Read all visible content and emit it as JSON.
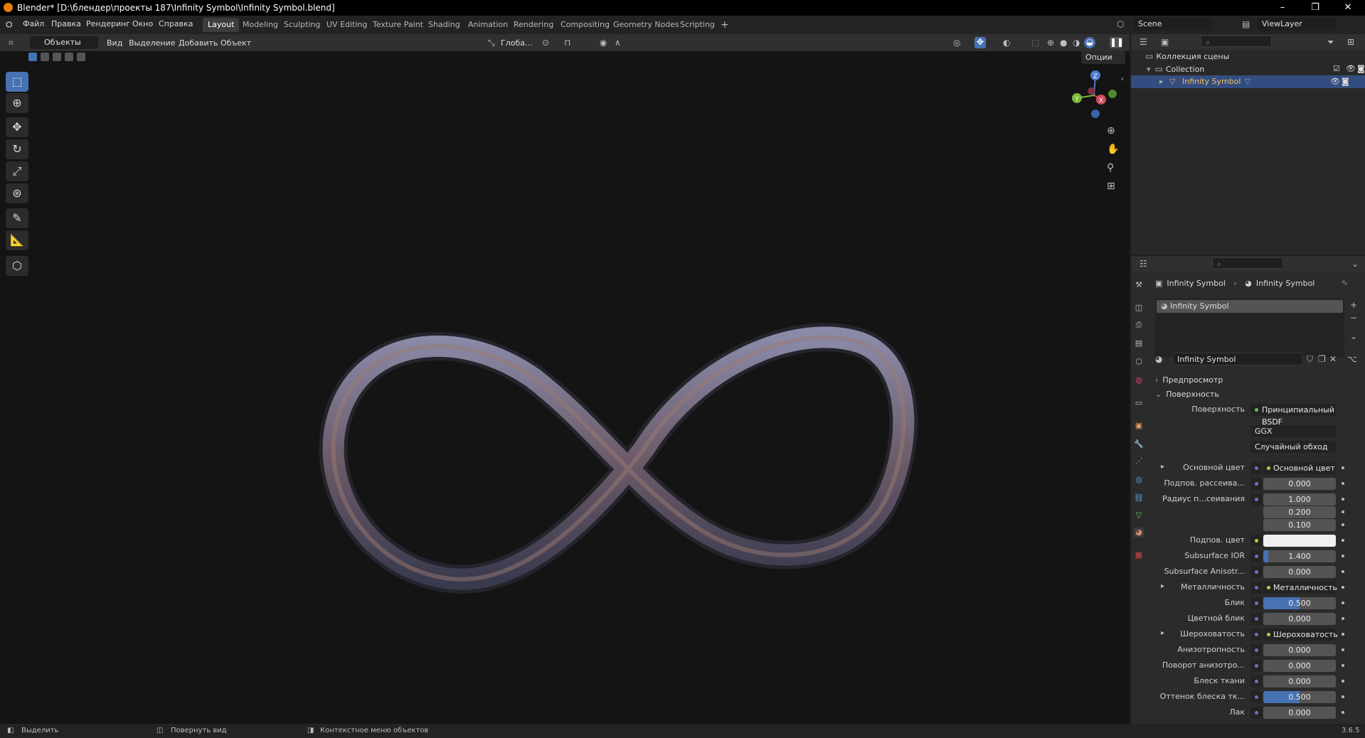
{
  "window": {
    "title": "Blender* [D:\\блендер\\проекты 187\\Infinity Symbol\\Infinity Symbol.blend]",
    "controls": [
      "–",
      "❐",
      "✕"
    ]
  },
  "menus": [
    "Файл",
    "Правка",
    "Рендеринг",
    "Окно",
    "Справка"
  ],
  "workspaces": [
    "Layout",
    "Modeling",
    "Sculpting",
    "UV Editing",
    "Texture Paint",
    "Shading",
    "Animation",
    "Rendering",
    "Compositing",
    "Geometry Nodes",
    "Scripting",
    "+"
  ],
  "active_workspace": "Layout",
  "scene": {
    "label": "Scene",
    "view_layer": "ViewLayer"
  },
  "viewport_header": {
    "mode": "Объекты",
    "menus": [
      "Вид",
      "Выделение",
      "Добавить",
      "Объект"
    ],
    "transform": "Глоба...",
    "options": "Опции"
  },
  "tools": [
    "select",
    "cursor",
    "move",
    "rotate",
    "scale",
    "transform",
    "annotate",
    "measure",
    "add-cube"
  ],
  "gizmo": {
    "z": "Z",
    "x": "X",
    "y": "Y"
  },
  "outliner": {
    "root": "Коллекция сцены",
    "collection": "Collection",
    "object": "Infinity Symbol"
  },
  "properties": {
    "breadcrumb_object": "Infinity Symbol",
    "breadcrumb_material": "Infinity Symbol",
    "slot": "Infinity Symbol",
    "material_name": "Infinity Symbol",
    "preview": "Предпросмотр",
    "surface_panel": "Поверхность",
    "surface_label": "Поверхность",
    "surface_value": "Принципиальный BSDF",
    "distribution": "GGX",
    "subsurface_method": "Случайный обход",
    "rows": [
      {
        "label": "Основной цвет",
        "value": "Основной цвет",
        "kind": "link",
        "expand": true
      },
      {
        "label": "Подпов. рассеива...",
        "value": "0.000",
        "kind": "num"
      },
      {
        "label": "Радиус п...сеивания",
        "value": "1.000",
        "kind": "num"
      },
      {
        "label": "",
        "value": "0.200",
        "kind": "num"
      },
      {
        "label": "",
        "value": "0.100",
        "kind": "num"
      },
      {
        "label": "Подпов. цвет",
        "value": "",
        "kind": "color"
      },
      {
        "label": "Subsurface IOR",
        "value": "1.400",
        "kind": "num",
        "fill": 0.07
      },
      {
        "label": "Subsurface Anisotr...",
        "value": "0.000",
        "kind": "num"
      },
      {
        "label": "Металличность",
        "value": "Металличность",
        "kind": "link",
        "expand": true
      },
      {
        "label": "Блик",
        "value": "0.500",
        "kind": "num",
        "fill": 0.5
      },
      {
        "label": "Цветной блик",
        "value": "0.000",
        "kind": "num"
      },
      {
        "label": "Шероховатость",
        "value": "Шероховатость",
        "kind": "link",
        "expand": true
      },
      {
        "label": "Анизотропность",
        "value": "0.000",
        "kind": "num"
      },
      {
        "label": "Поворот анизотро...",
        "value": "0.000",
        "kind": "num"
      },
      {
        "label": "Блеск ткани",
        "value": "0.000",
        "kind": "num"
      },
      {
        "label": "Оттенок блеска тк...",
        "value": "0.500",
        "kind": "num",
        "fill": 0.5
      },
      {
        "label": "Лак",
        "value": "0.000",
        "kind": "num"
      }
    ]
  },
  "status": {
    "select": "Выделить",
    "rotate": "Повернуть вид",
    "context": "Контекстное меню объектов",
    "version": "3.6.5"
  }
}
